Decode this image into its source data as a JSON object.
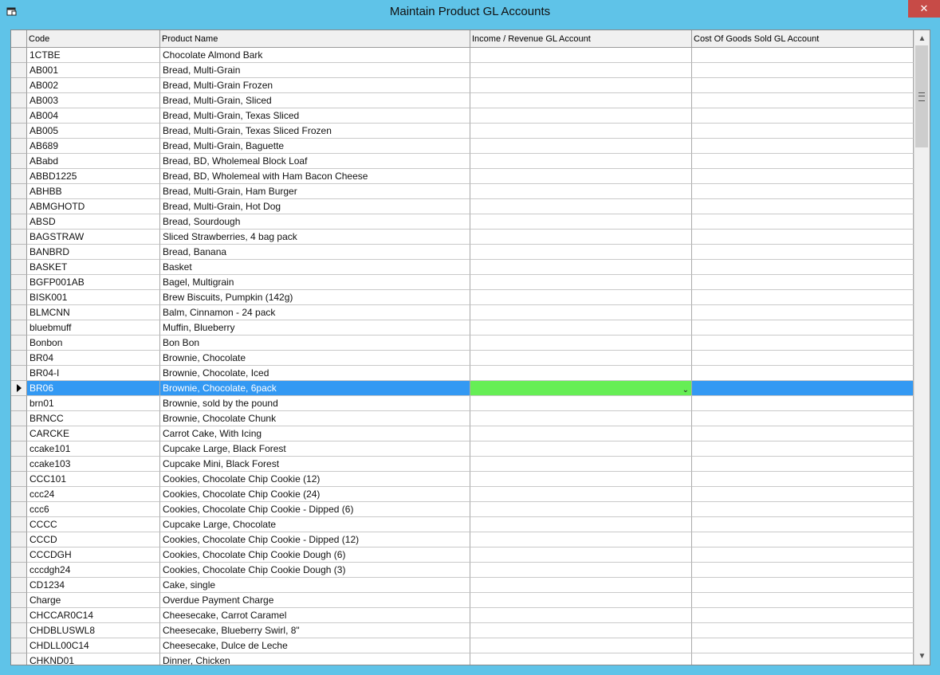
{
  "window": {
    "title": "Maintain Product GL Accounts",
    "close_label": "✕",
    "icon": "window-app-icon"
  },
  "grid": {
    "columns": [
      {
        "label": "Code"
      },
      {
        "label": "Product Name"
      },
      {
        "label": "Income / Revenue GL Account"
      },
      {
        "label": "Cost Of Goods Sold GL Account"
      }
    ],
    "selected_row_index": 22,
    "rows": [
      {
        "code": "1CTBE",
        "name": "Chocolate Almond Bark",
        "income": "",
        "cogs": ""
      },
      {
        "code": "AB001",
        "name": "Bread, Multi-Grain",
        "income": "",
        "cogs": ""
      },
      {
        "code": "AB002",
        "name": "Bread, Multi-Grain Frozen",
        "income": "",
        "cogs": ""
      },
      {
        "code": "AB003",
        "name": "Bread, Multi-Grain, Sliced",
        "income": "",
        "cogs": ""
      },
      {
        "code": "AB004",
        "name": "Bread, Multi-Grain, Texas Sliced",
        "income": "",
        "cogs": ""
      },
      {
        "code": "AB005",
        "name": "Bread, Multi-Grain, Texas Sliced Frozen",
        "income": "",
        "cogs": ""
      },
      {
        "code": "AB689",
        "name": "Bread, Multi-Grain, Baguette",
        "income": "",
        "cogs": ""
      },
      {
        "code": "ABabd",
        "name": "Bread, BD, Wholemeal Block Loaf",
        "income": "",
        "cogs": ""
      },
      {
        "code": "ABBD1225",
        "name": "Bread, BD, Wholemeal with Ham Bacon Cheese",
        "income": "",
        "cogs": ""
      },
      {
        "code": "ABHBB",
        "name": "Bread, Multi-Grain, Ham Burger",
        "income": "",
        "cogs": ""
      },
      {
        "code": "ABMGHOTD",
        "name": "Bread, Multi-Grain, Hot Dog",
        "income": "",
        "cogs": ""
      },
      {
        "code": "ABSD",
        "name": "Bread, Sourdough",
        "income": "",
        "cogs": ""
      },
      {
        "code": "BAGSTRAW",
        "name": "Sliced Strawberries, 4 bag pack",
        "income": "",
        "cogs": ""
      },
      {
        "code": "BANBRD",
        "name": "Bread, Banana",
        "income": "",
        "cogs": ""
      },
      {
        "code": "BASKET",
        "name": "Basket",
        "income": "",
        "cogs": ""
      },
      {
        "code": "BGFP001AB",
        "name": "Bagel, Multigrain",
        "income": "",
        "cogs": ""
      },
      {
        "code": "BISK001",
        "name": "Brew Biscuits, Pumpkin (142g)",
        "income": "",
        "cogs": ""
      },
      {
        "code": "BLMCNN",
        "name": "Balm, Cinnamon - 24 pack",
        "income": "",
        "cogs": ""
      },
      {
        "code": "bluebmuff",
        "name": "Muffin, Blueberry",
        "income": "",
        "cogs": ""
      },
      {
        "code": "Bonbon",
        "name": "Bon Bon",
        "income": "",
        "cogs": ""
      },
      {
        "code": "BR04",
        "name": "Brownie, Chocolate",
        "income": "",
        "cogs": ""
      },
      {
        "code": "BR04-I",
        "name": "Brownie, Chocolate, Iced",
        "income": "",
        "cogs": ""
      },
      {
        "code": "BR06",
        "name": "Brownie, Chocolate, 6pack",
        "income": "",
        "cogs": ""
      },
      {
        "code": "brn01",
        "name": "Brownie, sold by the pound",
        "income": "",
        "cogs": ""
      },
      {
        "code": "BRNCC",
        "name": "Brownie, Chocolate Chunk",
        "income": "",
        "cogs": ""
      },
      {
        "code": "CARCKE",
        "name": "Carrot Cake, With Icing",
        "income": "",
        "cogs": ""
      },
      {
        "code": "ccake101",
        "name": "Cupcake Large, Black Forest",
        "income": "",
        "cogs": ""
      },
      {
        "code": "ccake103",
        "name": "Cupcake Mini, Black Forest",
        "income": "",
        "cogs": ""
      },
      {
        "code": "CCC101",
        "name": "Cookies, Chocolate Chip Cookie (12)",
        "income": "",
        "cogs": ""
      },
      {
        "code": "ccc24",
        "name": "Cookies, Chocolate Chip Cookie (24)",
        "income": "",
        "cogs": ""
      },
      {
        "code": "ccc6",
        "name": "Cookies, Chocolate Chip Cookie - Dipped (6)",
        "income": "",
        "cogs": ""
      },
      {
        "code": "CCCC",
        "name": "Cupcake Large, Chocolate",
        "income": "",
        "cogs": ""
      },
      {
        "code": "CCCD",
        "name": "Cookies, Chocolate Chip Cookie - Dipped (12)",
        "income": "",
        "cogs": ""
      },
      {
        "code": "CCCDGH",
        "name": "Cookies, Chocolate Chip Cookie Dough (6)",
        "income": "",
        "cogs": ""
      },
      {
        "code": "cccdgh24",
        "name": "Cookies, Chocolate Chip Cookie Dough (3)",
        "income": "",
        "cogs": ""
      },
      {
        "code": "CD1234",
        "name": "Cake, single",
        "income": "",
        "cogs": ""
      },
      {
        "code": "Charge",
        "name": "Overdue Payment Charge",
        "income": "",
        "cogs": ""
      },
      {
        "code": "CHCCAR0C14",
        "name": "Cheesecake, Carrot Caramel",
        "income": "",
        "cogs": ""
      },
      {
        "code": "CHDBLUSWL8",
        "name": "Cheesecake, Blueberry Swirl, 8\"",
        "income": "",
        "cogs": ""
      },
      {
        "code": "CHDLL00C14",
        "name": "Cheesecake, Dulce de Leche",
        "income": "",
        "cogs": ""
      },
      {
        "code": "CHKND01",
        "name": "Dinner, Chicken",
        "income": "",
        "cogs": ""
      }
    ]
  },
  "scrollbar": {
    "up_icon": "chevron-up-icon",
    "down_icon": "chevron-down-icon"
  },
  "colors": {
    "title_bar": "#5fc3e8",
    "close_button": "#c74b47",
    "selection": "#3399f3",
    "editing_cell": "#66ee55"
  }
}
